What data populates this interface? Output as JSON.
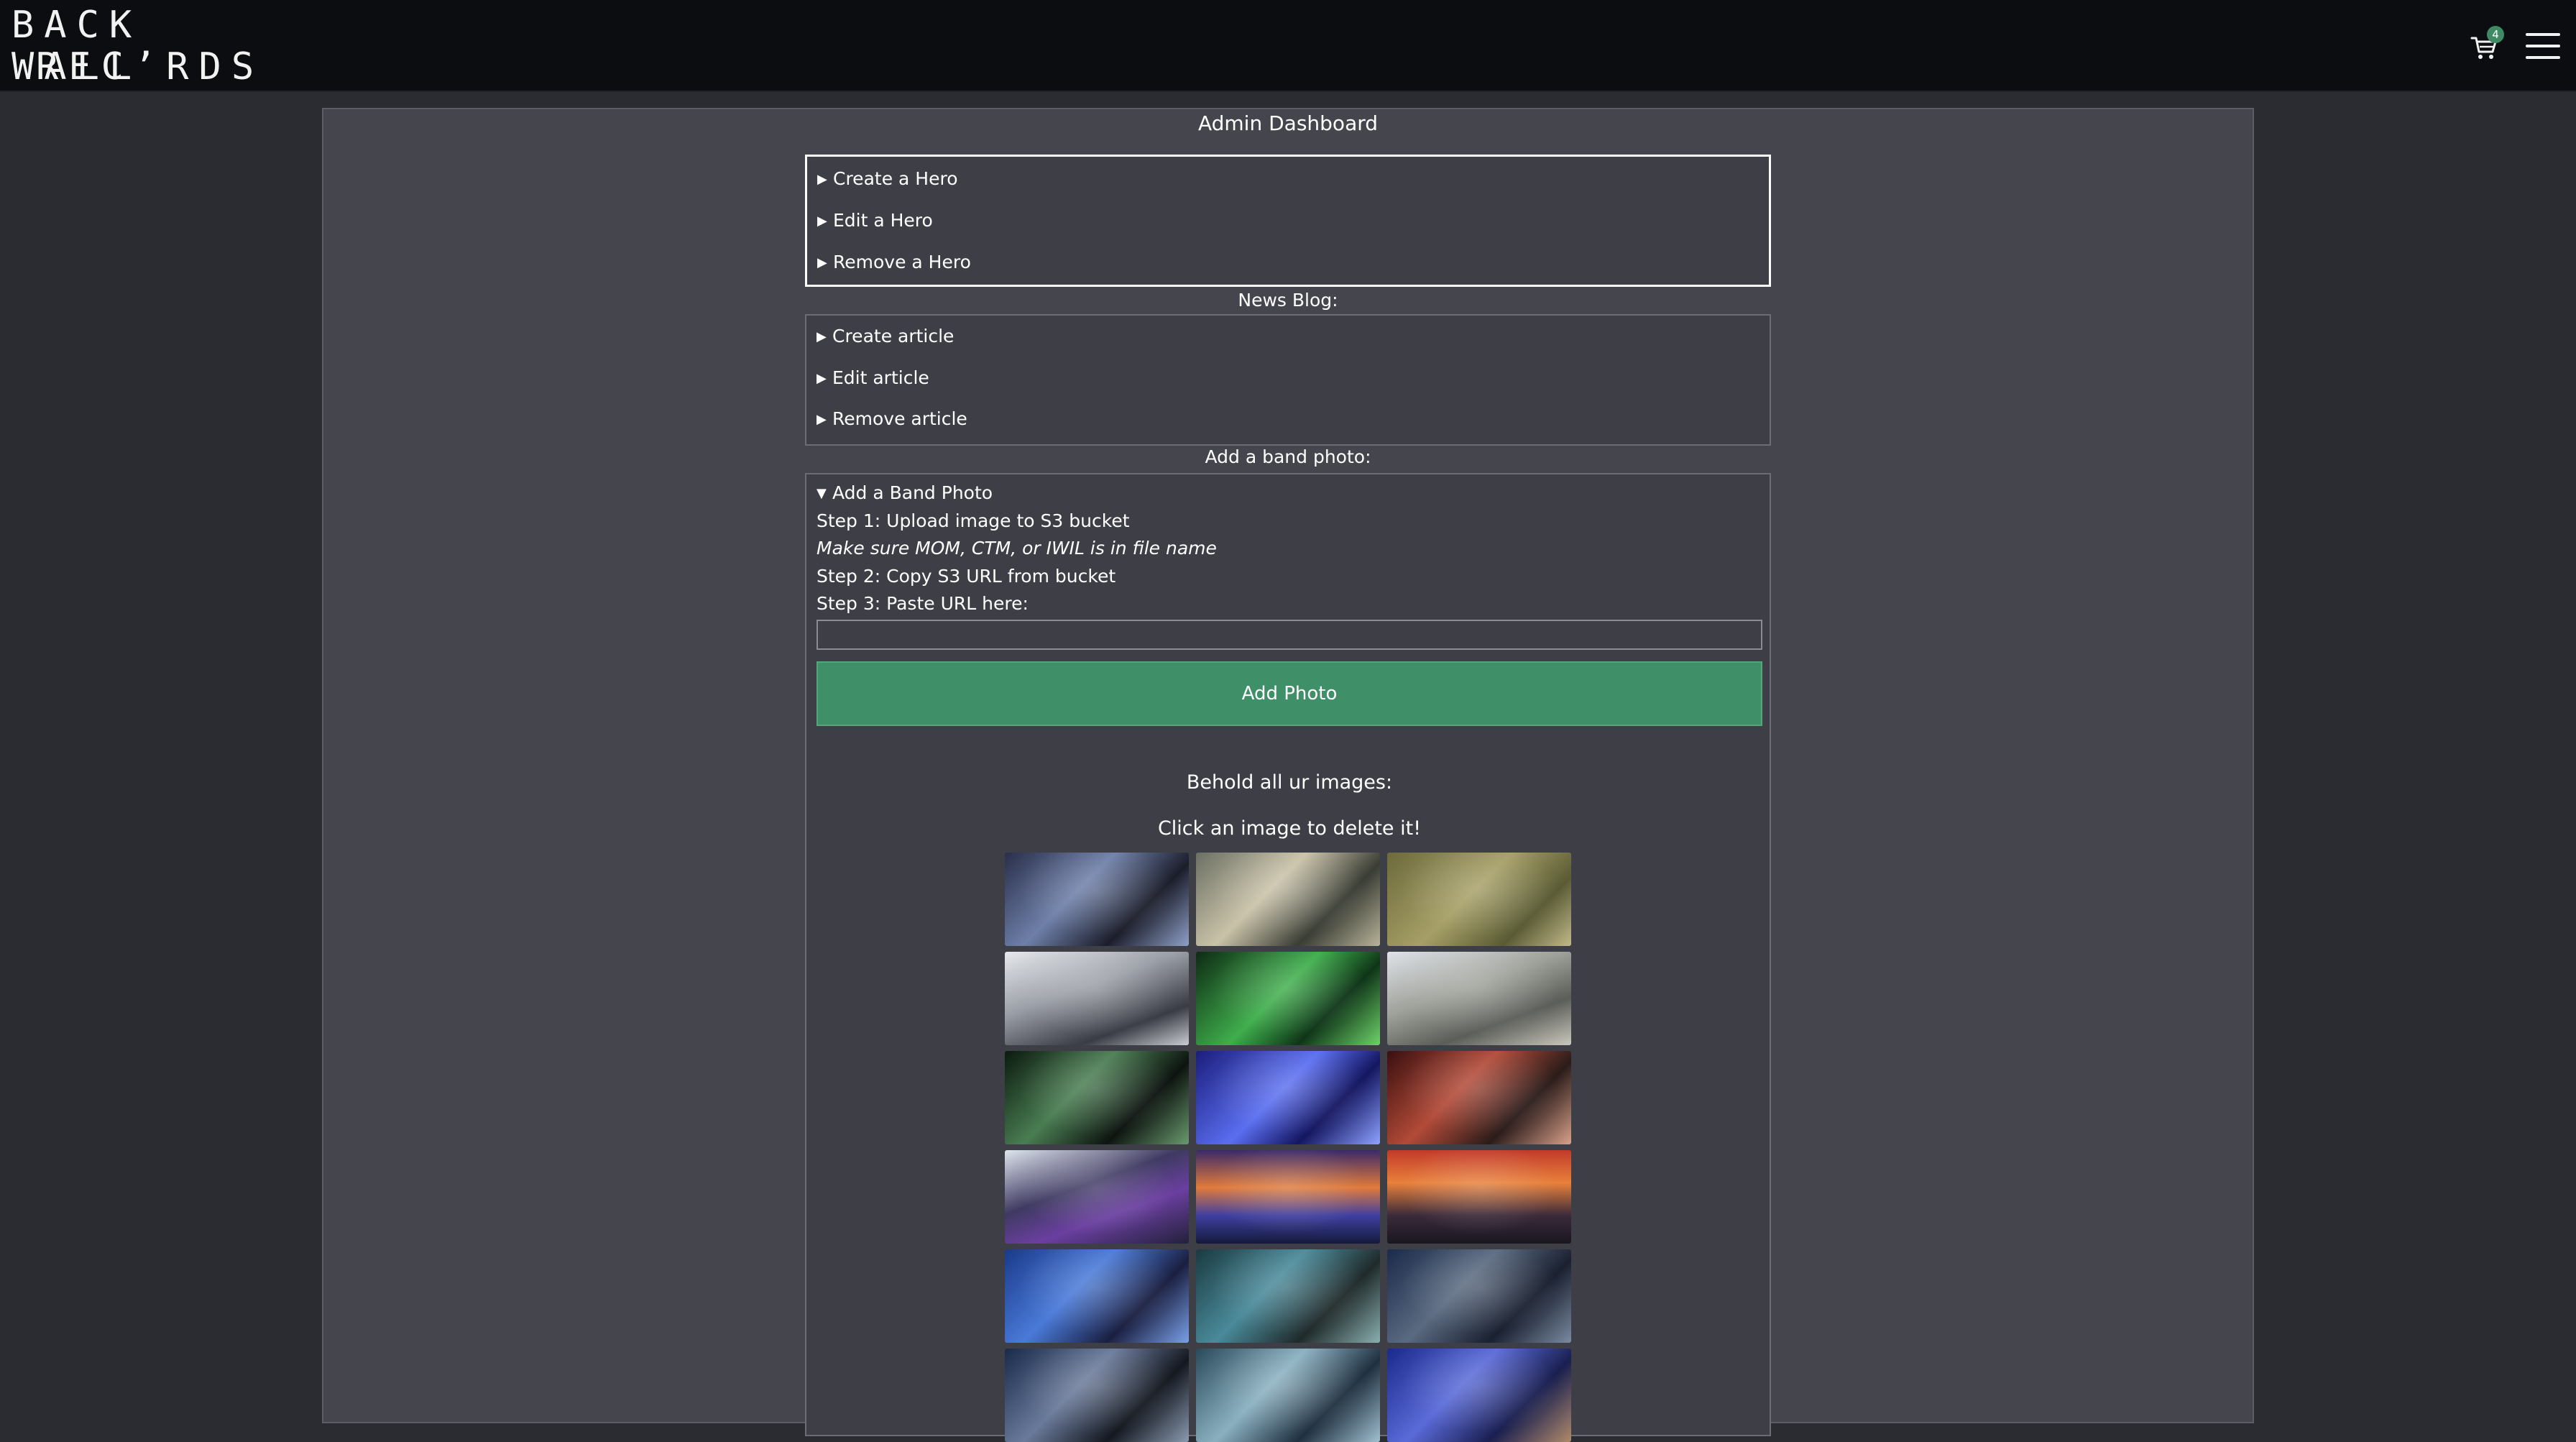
{
  "header": {
    "logo_line1": "BACK WALL",
    "logo_line2": "REC’RDS",
    "cart_count": "4",
    "cart_icon": "cart-icon",
    "menu_icon": "hamburger-menu-icon"
  },
  "dashboard": {
    "title": "Admin Dashboard"
  },
  "hero_section": {
    "items": [
      {
        "label": "Create a Hero"
      },
      {
        "label": "Edit a Hero"
      },
      {
        "label": "Remove a Hero"
      }
    ]
  },
  "news_section": {
    "heading": "News Blog:",
    "items": [
      {
        "label": "Create article"
      },
      {
        "label": "Edit article"
      },
      {
        "label": "Remove article"
      }
    ]
  },
  "photo_section": {
    "heading": "Add a band photo:",
    "summary": "Add a Band Photo",
    "step1": "Step 1: Upload image to S3 bucket",
    "note": "Make sure MOM, CTM, or IWIL is in file name",
    "step2": "Step 2: Copy S3 URL from bucket",
    "step3": "Step 3: Paste URL here:",
    "url_value": "",
    "button_label": "Add Photo",
    "behold_text": "Behold all ur images:",
    "delete_hint": "Click an image to delete it!"
  },
  "colors": {
    "accent_green": "#3f8f68",
    "panel_bg": "#45464d",
    "page_bg": "#2b2c31",
    "header_bg": "#0c0d10"
  },
  "gallery": [
    {
      "name": "band-photo-1",
      "bg": "linear-gradient(135deg,#2a2f4a,#6e7fa8 40%,#1b1d2a 70%,#8fa0c8)"
    },
    {
      "name": "band-photo-2",
      "bg": "linear-gradient(135deg,#6b6f63,#c9c2a8 40%,#3a3d35 70%,#b8b39a)"
    },
    {
      "name": "band-photo-3",
      "bg": "linear-gradient(135deg,#6c6a3c,#a69f66 45%,#5a5b35 75%,#c2b98a)"
    },
    {
      "name": "band-photo-4",
      "bg": "linear-gradient(160deg,#e6e8ec,#9a9ea6 40%,#3a3c45 75%,#c9ccd2)"
    },
    {
      "name": "band-photo-5",
      "bg": "linear-gradient(135deg,#0e2a14,#3fae4c 45%,#0f3518 70%,#6fd36a)"
    },
    {
      "name": "band-photo-6",
      "bg": "linear-gradient(160deg,#dfe3e9,#9fa29a 40%,#5b5d58 70%,#c9c8bd)"
    },
    {
      "name": "band-photo-7",
      "bg": "linear-gradient(135deg,#0b1a0f,#4a7d52 40%,#0d1410 70%,#6a9a6e)"
    },
    {
      "name": "band-photo-8",
      "bg": "linear-gradient(135deg,#1b1d7a,#5a6ef0 45%,#141660 70%,#8ea2ff)"
    },
    {
      "name": "band-photo-9",
      "bg": "linear-gradient(135deg,#3a1010,#b24a38 40%,#2b1c1a 70%,#d8a08a)"
    },
    {
      "name": "band-photo-10",
      "bg": "linear-gradient(160deg,#dfe6ee,#3f3a62 40%,#6a3fa0 65%,#23213a)"
    },
    {
      "name": "band-photo-11",
      "bg": "linear-gradient(180deg,#3b2a6a,#e07a3a 40%,#3f3fa0 70%,#141a3a)"
    },
    {
      "name": "band-photo-12",
      "bg": "linear-gradient(180deg,#c23a2a,#e8803a 35%,#3a2a3a 70%,#1a1620)"
    },
    {
      "name": "band-photo-13",
      "bg": "linear-gradient(135deg,#1a3a8a,#4a7ad8 40%,#1a1f40 70%,#7aa0e8)"
    },
    {
      "name": "band-photo-14",
      "bg": "linear-gradient(135deg,#1a3a40,#4a8a9a 40%,#202a2a 70%,#8ab0b0)"
    },
    {
      "name": "band-photo-15",
      "bg": "linear-gradient(135deg,#1a2a4a,#5a6a80 40%,#1a2030 70%,#7a8aa0)"
    },
    {
      "name": "band-photo-16",
      "bg": "linear-gradient(135deg,#1a2a4a,#6a7a9a 40%,#141820 70%,#8a9ab0)"
    },
    {
      "name": "band-photo-17",
      "bg": "linear-gradient(135deg,#2a4a5a,#8ab0c0 40%,#203040 70%,#a0c0d0)"
    },
    {
      "name": "band-photo-18",
      "bg": "linear-gradient(135deg,#1a2a8a,#5a6ad8 40%,#1a1f50 70%,#b08a6a)"
    }
  ]
}
